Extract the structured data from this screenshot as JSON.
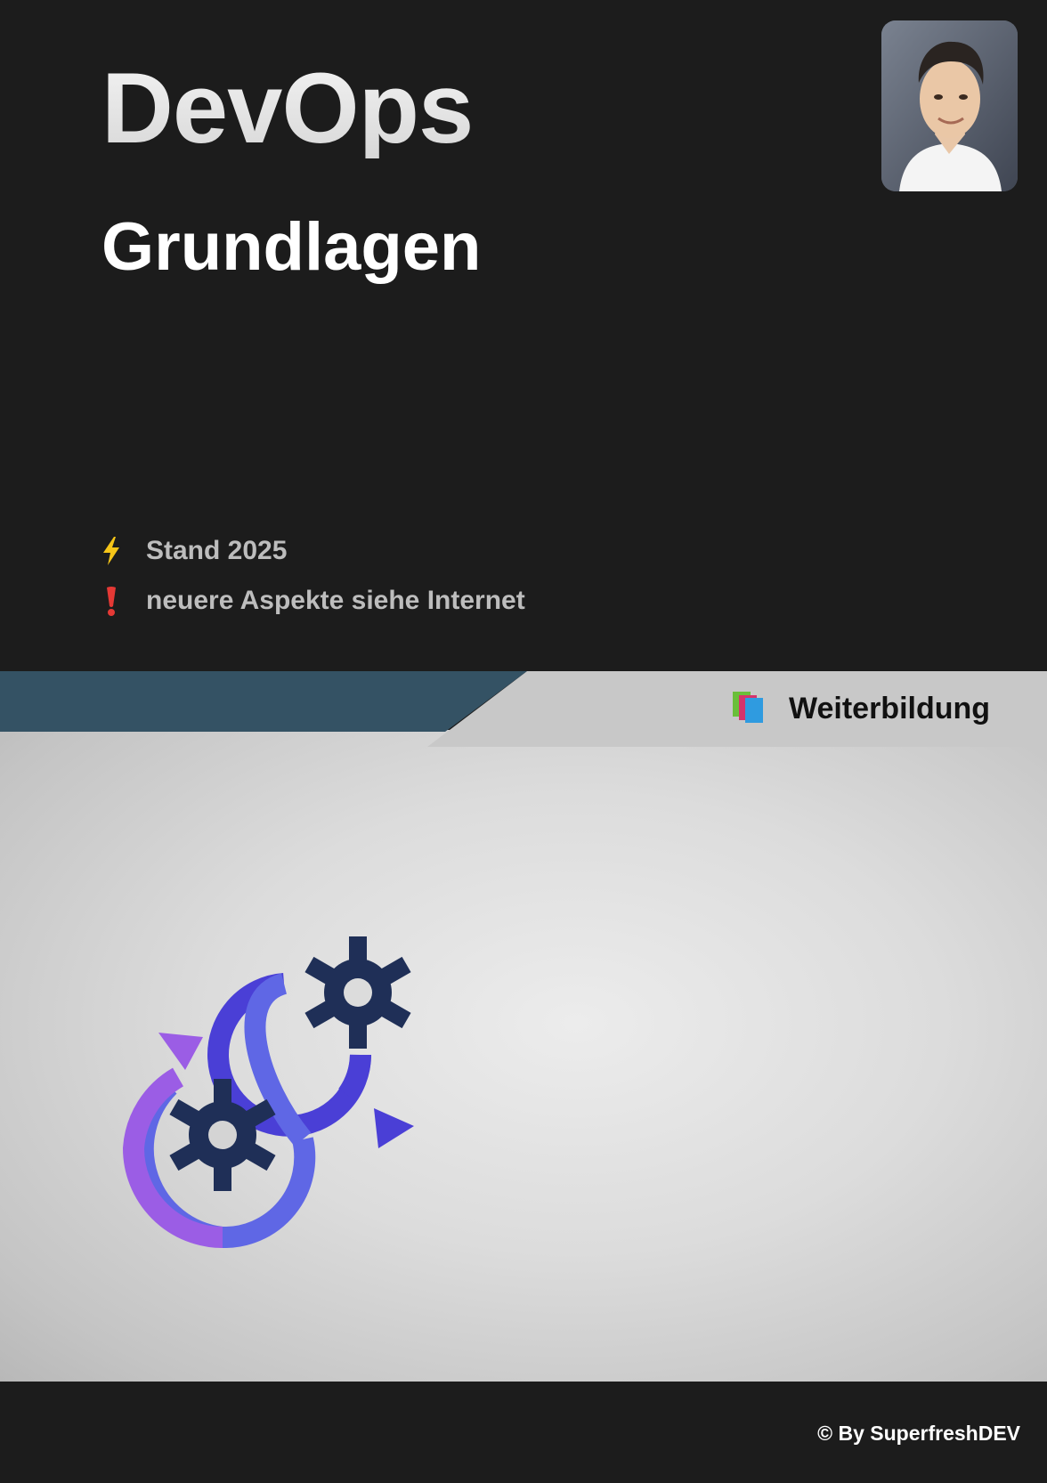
{
  "cover": {
    "title": "DevOps",
    "subtitle": "Grundlagen"
  },
  "info": [
    {
      "icon": "lightning-icon",
      "text": "Stand 2025"
    },
    {
      "icon": "exclamation-icon",
      "text": "neuere Aspekte siehe Internet"
    }
  ],
  "band": {
    "icon": "books-icon",
    "label": "Weiterbildung"
  },
  "footer": {
    "copyright": "© By SuperfreshDEV"
  },
  "colors": {
    "background": "#1c1c1c",
    "band_blue": "#345264",
    "band_grey": "#c8c8c8",
    "gear": "#1f2f57",
    "loop_purple": "#9b5de5",
    "loop_blue": "#5f67e5",
    "loop_indigo": "#4a3fd6",
    "lightning": "#f5c518",
    "exclamation": "#e53935"
  }
}
